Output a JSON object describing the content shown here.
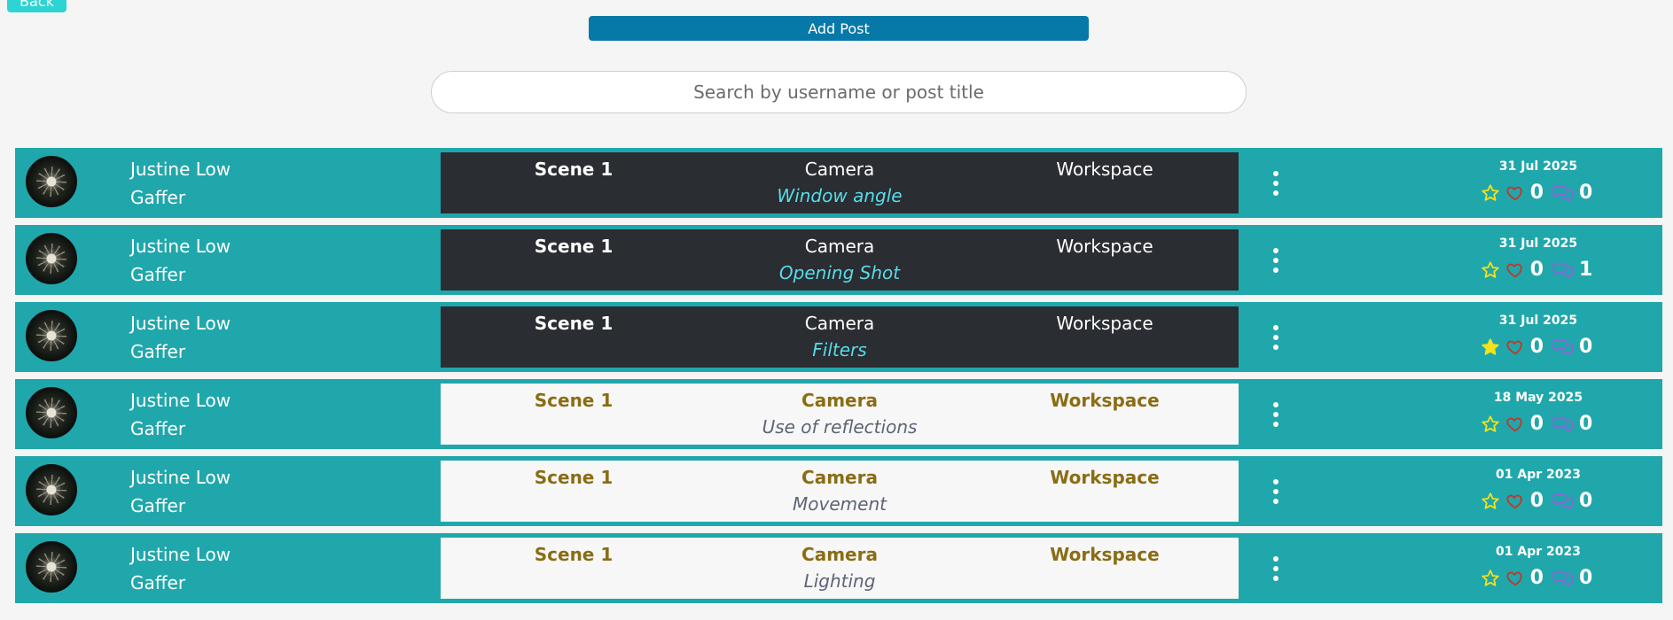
{
  "header": {
    "back_label": "Back",
    "add_post_label": "Add Post"
  },
  "search": {
    "placeholder": "Search by username or post title",
    "value": ""
  },
  "colors": {
    "row_bg": "#20a7ab",
    "dark_panel": "#2a2d31",
    "light_panel": "#f7f7f7",
    "title_dark": "#58dbe9",
    "title_light": "#5d6476",
    "light_label": "#8a6d14",
    "add_button": "#0679a9",
    "back_button": "#2ed3d3",
    "star": "#f2e21b",
    "heart": "#c0392b",
    "comment": "#8b64d9"
  },
  "posts": [
    {
      "name": "Justine Low",
      "role": "Gaffer",
      "scene": "Scene 1",
      "department": "Camera",
      "category": "Workspace",
      "title": "Window angle",
      "theme": "dark",
      "date": "31 Jul 2025",
      "starred": false,
      "likes": "0",
      "comments": "0",
      "star_icon": "star-outline-icon",
      "heart_icon": "heart-outline-icon",
      "comment_icon": "comment-icon",
      "menu_icon": "more-vertical-icon"
    },
    {
      "name": "Justine Low",
      "role": "Gaffer",
      "scene": "Scene 1",
      "department": "Camera",
      "category": "Workspace",
      "title": "Opening Shot",
      "theme": "dark",
      "date": "31 Jul 2025",
      "starred": false,
      "likes": "0",
      "comments": "1",
      "star_icon": "star-outline-icon",
      "heart_icon": "heart-outline-icon",
      "comment_icon": "comment-icon",
      "menu_icon": "more-vertical-icon"
    },
    {
      "name": "Justine Low",
      "role": "Gaffer",
      "scene": "Scene 1",
      "department": "Camera",
      "category": "Workspace",
      "title": "Filters",
      "theme": "dark",
      "date": "31 Jul 2025",
      "starred": true,
      "likes": "0",
      "comments": "0",
      "star_icon": "star-filled-icon",
      "heart_icon": "heart-outline-icon",
      "comment_icon": "comment-icon",
      "menu_icon": "more-vertical-icon"
    },
    {
      "name": "Justine Low",
      "role": "Gaffer",
      "scene": "Scene 1",
      "department": "Camera",
      "category": "Workspace",
      "title": "Use of reflections",
      "theme": "light",
      "date": "18 May 2025",
      "starred": false,
      "likes": "0",
      "comments": "0",
      "star_icon": "star-outline-icon",
      "heart_icon": "heart-outline-icon",
      "comment_icon": "comment-icon",
      "menu_icon": "more-vertical-icon"
    },
    {
      "name": "Justine Low",
      "role": "Gaffer",
      "scene": "Scene 1",
      "department": "Camera",
      "category": "Workspace",
      "title": "Movement",
      "theme": "light",
      "date": "01 Apr 2023",
      "starred": false,
      "likes": "0",
      "comments": "0",
      "star_icon": "star-outline-icon",
      "heart_icon": "heart-outline-icon",
      "comment_icon": "comment-icon",
      "menu_icon": "more-vertical-icon"
    },
    {
      "name": "Justine Low",
      "role": "Gaffer",
      "scene": "Scene 1",
      "department": "Camera",
      "category": "Workspace",
      "title": "Lighting",
      "theme": "light",
      "date": "01 Apr 2023",
      "starred": false,
      "likes": "0",
      "comments": "0",
      "star_icon": "star-outline-icon",
      "heart_icon": "heart-outline-icon",
      "comment_icon": "comment-icon",
      "menu_icon": "more-vertical-icon"
    }
  ]
}
